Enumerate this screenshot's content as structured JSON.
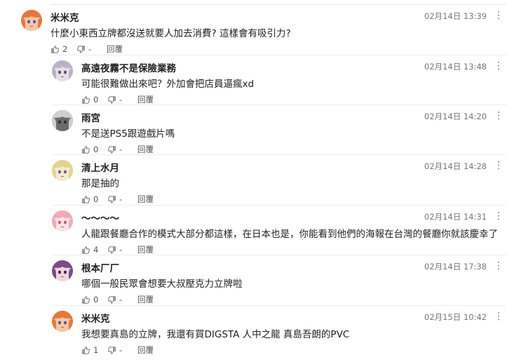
{
  "comments": [
    {
      "user": "米米克",
      "time": "02月14日 13:39",
      "text": "什麼小東西立牌都沒送就要人加去消費? 這樣會有吸引力?",
      "likes": "2",
      "dislikes": "-",
      "reply_label": "回覆",
      "avatar": "avatar-orange-hair",
      "avatar_colors": [
        "#e9763a",
        "#f5c7a4",
        "#3a5fb0"
      ]
    },
    {
      "user": "高遠夜霧不是保險業務",
      "time": "02月14日 13:48",
      "text": "可能很難做出來吧？外加會把店員逼瘋xd",
      "likes": "0",
      "dislikes": "-",
      "reply_label": "回覆",
      "avatar": "avatar-silver-hair",
      "avatar_colors": [
        "#b9b3c9",
        "#e8dfe6",
        "#5b4a78"
      ]
    },
    {
      "user": "雨宮",
      "time": "02月14日 14:20",
      "text": "不是送PS5跟遊戲片嗎",
      "likes": "0",
      "dislikes": "-",
      "reply_label": "回覆",
      "avatar": "avatar-grey-hair",
      "avatar_colors": [
        "#cfcfcf",
        "#6b6b6b",
        "#2f2f2f"
      ]
    },
    {
      "user": "清上水月",
      "time": "02月14日 14:28",
      "text": "那是抽的",
      "likes": "0",
      "dislikes": "-",
      "reply_label": "回覆",
      "avatar": "avatar-blonde-hair",
      "avatar_colors": [
        "#e6d28a",
        "#f3ead2",
        "#6a5a8c"
      ]
    },
    {
      "user": "～～～～",
      "time": "02月14日 14:31",
      "text": "人龍跟餐廳合作的模式大部分都這樣，在日本也是，你能看到他們的海報在台灣的餐廳你就該慶幸了",
      "likes": "4",
      "dislikes": "-",
      "reply_label": "回覆",
      "avatar": "avatar-pink-hair",
      "avatar_colors": [
        "#f1a9b8",
        "#fbe3e6",
        "#c55a7a"
      ]
    },
    {
      "user": "根本厂厂",
      "time": "02月14日 17:38",
      "text": "哪個一般民眾會想要大叔壓克力立牌啦",
      "likes": "0",
      "dislikes": "-",
      "reply_label": "回覆",
      "avatar": "avatar-purple-hair",
      "avatar_colors": [
        "#7a4a8c",
        "#f2d4dc",
        "#3b2350"
      ]
    },
    {
      "user": "米米克",
      "time": "02月15日 10:42",
      "text": "我想要真島的立牌，我還有買DIGSTA 人中之龍 真島吾朗的PVC",
      "likes": "1",
      "dislikes": "-",
      "reply_label": "回覆",
      "avatar": "avatar-orange-hair",
      "avatar_colors": [
        "#e9763a",
        "#f5c7a4",
        "#3a5fb0"
      ]
    }
  ],
  "icons": {
    "like": "thumbs-up-icon",
    "dislike": "thumbs-down-icon",
    "more": "more-vertical-icon"
  }
}
